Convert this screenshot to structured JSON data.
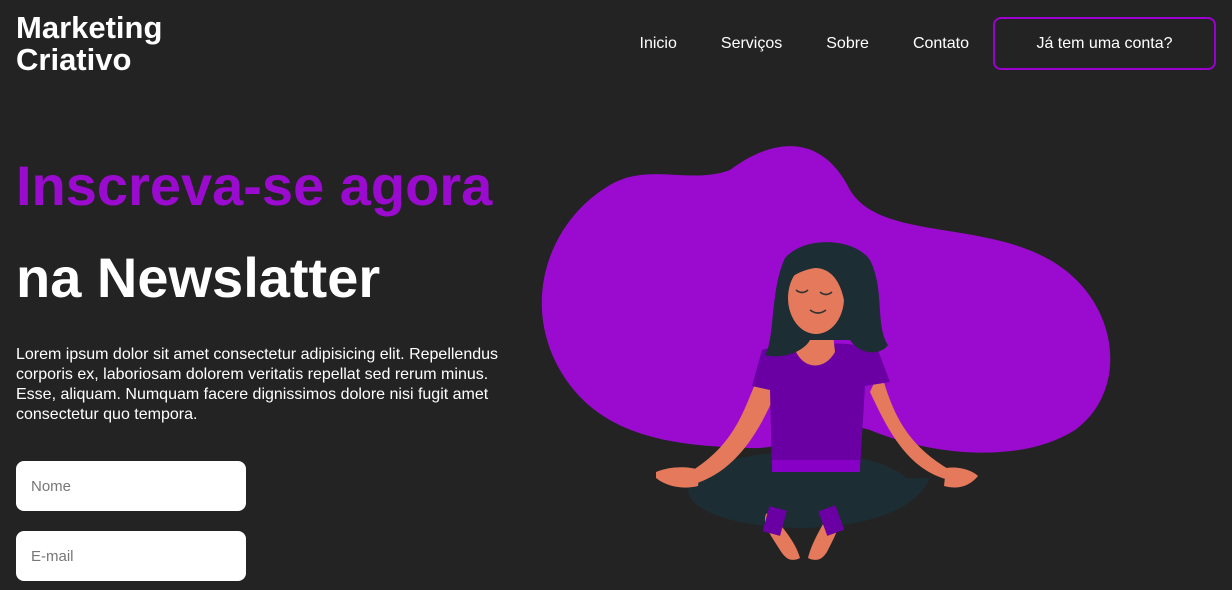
{
  "header": {
    "logo": "Marketing Criativo",
    "nav": [
      "Inicio",
      "Serviços",
      "Sobre",
      "Contato"
    ],
    "account_button": "Já tem uma conta?"
  },
  "hero": {
    "headline": "Inscreva-se agora",
    "subheadline": "na Newslatter",
    "description": "Lorem ipsum dolor sit amet consectetur adipisicing elit. Repellendus corporis ex, laboriosam dolorem veritatis repellat sed rerum minus. Esse, aliquam. Numquam facere dignissimos dolore nisi fugit amet consectetur quo tempora."
  },
  "form": {
    "name_placeholder": "Nome",
    "email_placeholder": "E-mail"
  },
  "colors": {
    "background": "#232323",
    "accent": "#9b0bcf",
    "text": "#ffffff"
  },
  "illustration": {
    "subject": "woman-meditating-illustration"
  }
}
